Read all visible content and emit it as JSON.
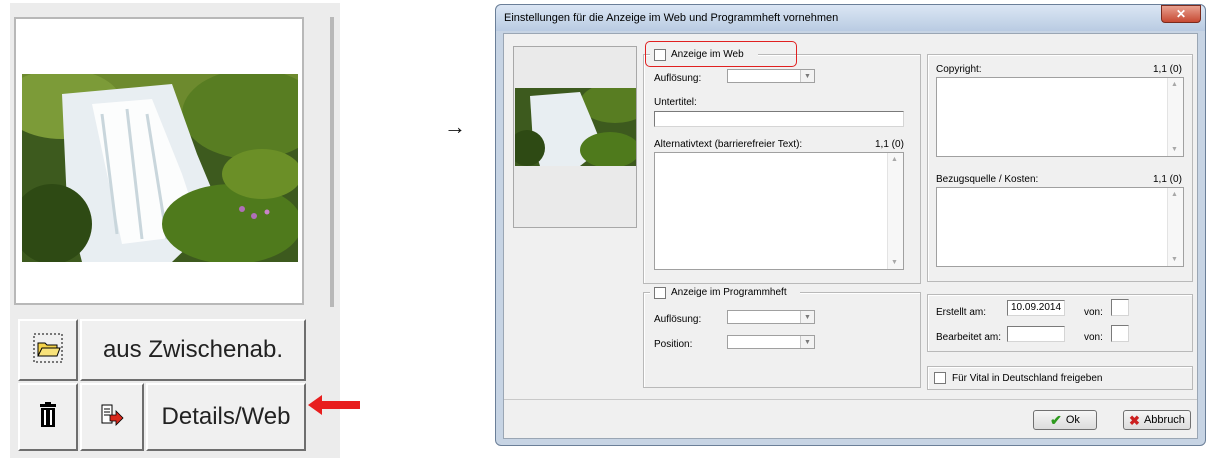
{
  "left_panel": {
    "paste_label": "aus Zwischenab.",
    "details_label": "Details/Web",
    "arrow_glyph": "→"
  },
  "dialog": {
    "title": "Einstellungen für die Anzeige im Web und Programmheft vornehmen",
    "close_glyph": "✕",
    "web": {
      "checkbox_label": "Anzeige im Web",
      "resolution_label": "Auflösung:",
      "resolution_value": "",
      "subtitle_label": "Untertitel:",
      "subtitle_value": "",
      "alt_label": "Alternativtext (barrierefreier Text):",
      "alt_counter": "1,1 (0)",
      "alt_value": ""
    },
    "right": {
      "copyright_label": "Copyright:",
      "copyright_counter": "1,1 (0)",
      "source_label": "Bezugsquelle / Kosten:",
      "source_counter": "1,1 (0)"
    },
    "program": {
      "checkbox_label": "Anzeige im Programmheft",
      "resolution_label": "Auflösung:",
      "position_label": "Position:"
    },
    "dates": {
      "created_label": "Erstellt am:",
      "created_value": "10.09.2014",
      "edited_label": "Bearbeitet am:",
      "edited_value": "",
      "from_label": "von:",
      "from_value": "",
      "from2_label": "von:",
      "from2_value": ""
    },
    "release_label": "Für Vital in Deutschland freigeben",
    "ok_label": "Ok",
    "cancel_label": "Abbruch",
    "colors": {
      "highlight": "#e02020",
      "ok_check": "#2e9a1e",
      "cancel_x": "#cc2020"
    }
  },
  "icons": [
    "folder-icon",
    "trash-icon",
    "export-icon",
    "red-arrow-icon",
    "checkmark-icon",
    "x-icon"
  ]
}
